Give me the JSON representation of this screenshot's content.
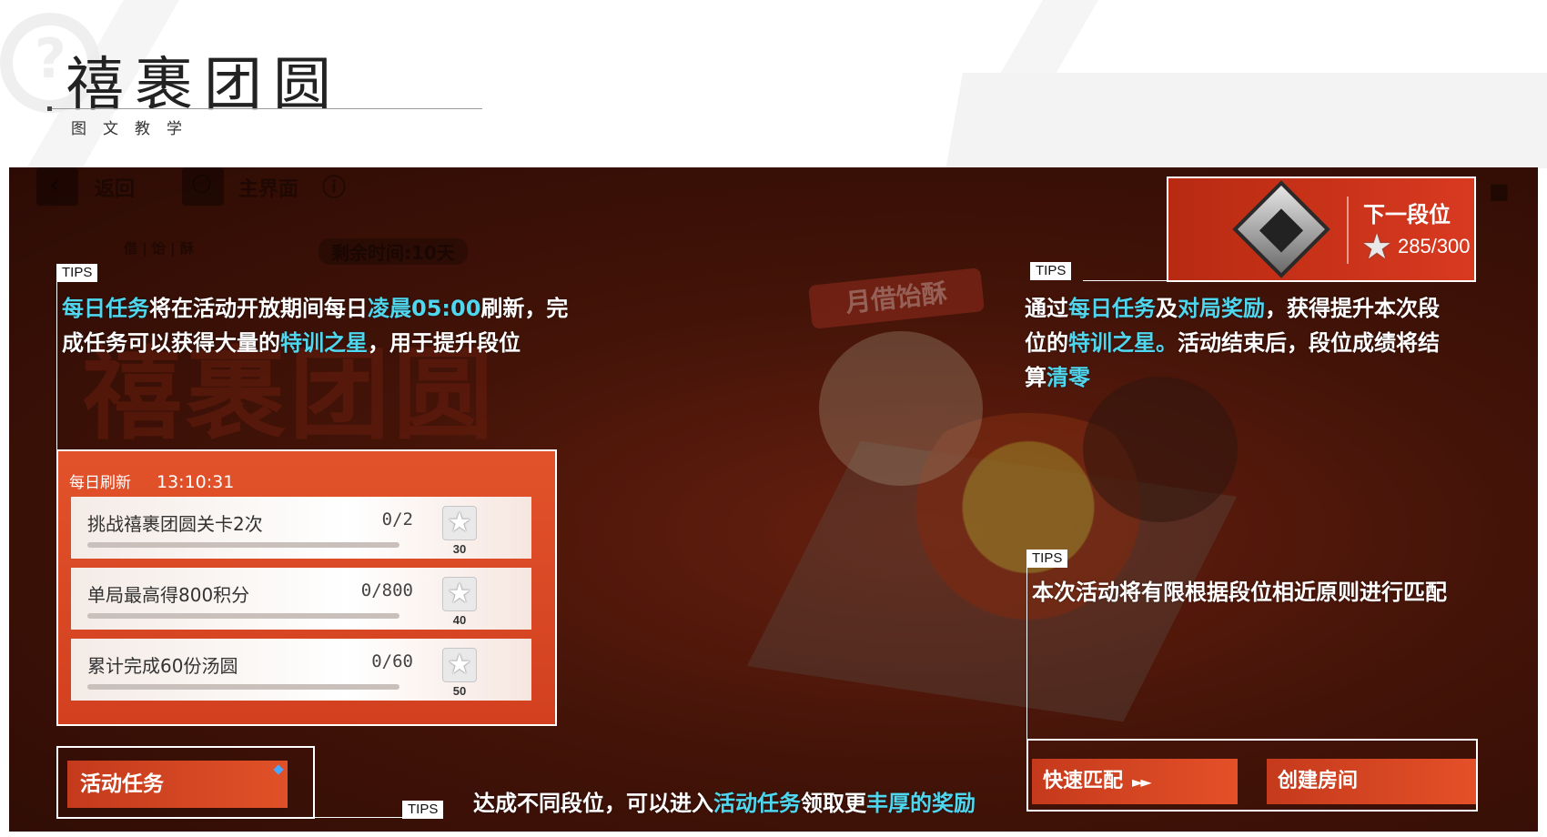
{
  "header": {
    "title": "禧裹团圆",
    "subtitle": "图文教学"
  },
  "game": {
    "nav": {
      "back_label": "返回",
      "home_label": "主界面"
    },
    "event_tabs": "借 | 饴 | 酥",
    "remaining_time": "剩余时间:10天",
    "banner_text": "月借饴酥"
  },
  "tips_label": "TIPS",
  "tips": {
    "daily": {
      "segments": [
        {
          "text": "每日任务",
          "hl": true
        },
        {
          "text": "将在活动开放期间每日",
          "hl": false
        },
        {
          "text": "凌晨05:00",
          "hl": true
        },
        {
          "text": "刷新，完",
          "hl": false
        }
      ],
      "segments2": [
        {
          "text": "成任务可以获得大量的",
          "hl": false
        },
        {
          "text": "特训之星",
          "hl": true
        },
        {
          "text": "，用于提升段位",
          "hl": false
        }
      ]
    },
    "rank": {
      "line1": [
        {
          "text": "通过",
          "hl": false
        },
        {
          "text": "每日任务",
          "hl": true
        },
        {
          "text": "及",
          "hl": false
        },
        {
          "text": "对局奖励",
          "hl": true
        },
        {
          "text": "，获得提升本次段",
          "hl": false
        }
      ],
      "line2": [
        {
          "text": "位的",
          "hl": false
        },
        {
          "text": "特训之星",
          "hl": true
        },
        {
          "text": "。",
          "hl": true
        },
        {
          "text": "活动结束后，段位成绩将结",
          "hl": false
        }
      ],
      "line3": [
        {
          "text": "算",
          "hl": false
        },
        {
          "text": "清零",
          "hl": true
        }
      ]
    },
    "match": "本次活动将有限根据段位相近原则进行匹配",
    "reward": [
      {
        "text": "达成不同段位，可以进入",
        "hl": false
      },
      {
        "text": "活动任务",
        "hl": true
      },
      {
        "text": "领取更",
        "hl": false
      },
      {
        "text": "丰厚的奖励",
        "hl": true
      }
    ]
  },
  "task_panel": {
    "label": "每日刷新",
    "timer": "13:10:31",
    "tasks": [
      {
        "name": "挑战禧裹团圆关卡2次",
        "progress": "0/2",
        "fraction": 0,
        "reward": "30"
      },
      {
        "name": "单局最高得800积分",
        "progress": "0/800",
        "fraction": 0,
        "reward": "40"
      },
      {
        "name": "累计完成60份汤圆",
        "progress": "0/60",
        "fraction": 0,
        "reward": "50"
      }
    ]
  },
  "activity_button": "活动任务",
  "rank_widget": {
    "next_label": "下一段位",
    "score": "285/300"
  },
  "match_buttons": {
    "quick_match": "快速匹配",
    "quick_arrow": "►►",
    "create_room": "创建房间"
  },
  "colors": {
    "highlight": "#4fd7f0",
    "accent": "#e2522a"
  }
}
